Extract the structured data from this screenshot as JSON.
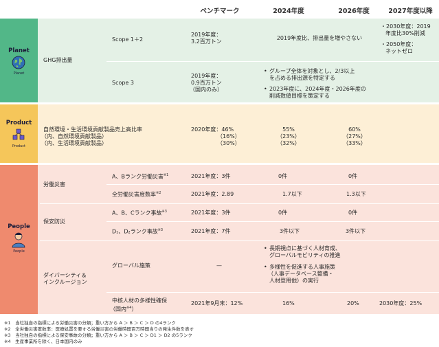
{
  "header": {
    "benchmark": "ベンチマーク",
    "y2024": "2024年度",
    "y2026": "2026年度",
    "y2027": "2027年度以降"
  },
  "planet": {
    "label": "Planet",
    "sub": "Planet",
    "metric": "GHG排出量",
    "scope12": {
      "label": "Scope 1＋2",
      "bench1": "2019年度：",
      "bench2": "3.2百万トン",
      "target": "2019年度比、排出量を増やさない",
      "later1a": "・2030年度：2019",
      "later1b": "年度比30%削減",
      "later2a": "・2050年度：",
      "later2b": "ネットゼロ"
    },
    "scope3": {
      "label": "Scope 3",
      "bench1": "2019年度：",
      "bench2": "0.9百万トン",
      "bench3": "（国内のみ）",
      "b1a": "グループ全体を対象とし、2/3以上",
      "b1b": "を占める排出源を特定する",
      "b2a": "2023年度に、2024年度・2026年度の",
      "b2b": "削減数値目標を策定する"
    }
  },
  "product": {
    "label": "Product",
    "sub": "Product",
    "m1": "自然環境・生活環境貢献製品売上高比率",
    "m2": "（内、自然環境貢献製品）",
    "m3": "（内、生活環境貢献製品）",
    "bench1": "2020年度：46%",
    "bench2": "（16%）",
    "bench3": "（30%）",
    "t24a": "55%",
    "t24b": "（23%）",
    "t24c": "（32%）",
    "t26a": "60%",
    "t26b": "（27%）",
    "t26c": "（33%）"
  },
  "people": {
    "label": "People",
    "sub": "People",
    "labor": {
      "label": "労働災害",
      "r1": {
        "label": "A、Bランク労働災害",
        "note": "※1",
        "bench": "2021年度：3件",
        "t24": "0件",
        "t26": "0件"
      },
      "r2": {
        "label": "全労働災害度数率",
        "note": "※2",
        "bench": "2021年度：2.89",
        "t24": "1.7以下",
        "t26": "1.3以下"
      }
    },
    "safety": {
      "label": "保安防災",
      "r1": {
        "label": "A、B、Cランク事故",
        "note": "※3",
        "bench": "2021年度：3件",
        "t24": "0件",
        "t26": "0件"
      },
      "r2": {
        "label": "D₁、D₂ランク事故",
        "note": "※3",
        "bench": "2021年度：7件",
        "t24": "3件以下",
        "t26": "3件以下"
      }
    },
    "diversity": {
      "label1": "ダイバーシティ＆",
      "label2": "インクルージョン",
      "global": {
        "label": "グローバル施策",
        "bench": "—",
        "b1a": "長期視点に基づく人材育成、",
        "b1b": "グローバルモビリティの推進",
        "b2a": "多様性を促進する人事施策",
        "b2b": "（人事データベース整備・",
        "b2c": "人材登用他）の実行"
      },
      "core": {
        "label1": "中核人材の多様性確保",
        "label2": "（国内",
        "note": "※4",
        "label3": "）",
        "bench": "2021年9月末：12%",
        "t24": "16%",
        "t26": "20%",
        "later": "2030年度：25%"
      }
    }
  },
  "footnotes": [
    "※1　当社独自の指標による労働災害の分類；重い方から A ＞ B ＞ C ＞ D の4ランク",
    "※2　全労働災害度数率：医療処置を要する労働災害の労働時間百万時間当りの発生件数を表す",
    "※3　当社独自の指標による保安事故の分類；重い方から A ＞ B ＞ C ＞ D1 ＞ D2 の5ランク",
    "※4　生産事業所を除く、日本国内のみ"
  ],
  "colors": {
    "planet_band": "#e4f1e6",
    "planet_cat": "#52b788",
    "product_band": "#fdefd6",
    "product_cat": "#f5c65a",
    "people_band": "#fbe3dc",
    "people_cat": "#ef8a6e"
  },
  "icons": [
    "globe-icon",
    "cubes-icon",
    "person-icon"
  ]
}
